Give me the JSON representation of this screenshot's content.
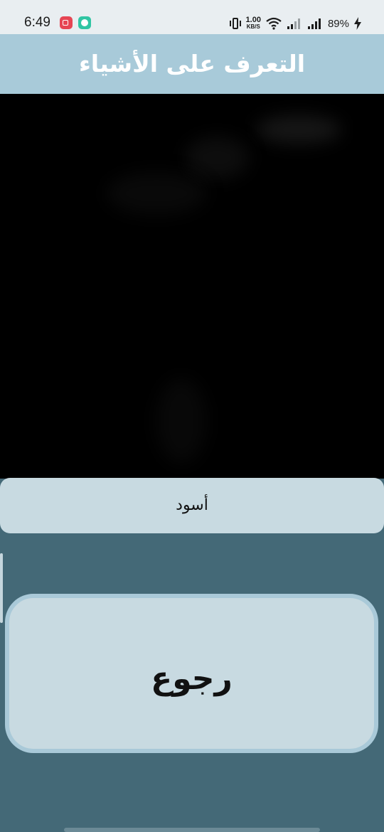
{
  "status_bar": {
    "time": "6:49",
    "net_speed_value": "1.00",
    "net_speed_unit": "KB/S",
    "battery": "89%",
    "icons": [
      "screen-record-icon",
      "chat-notification-icon",
      "vibrate-icon",
      "wifi-icon",
      "signal-icon",
      "signal-icon",
      "charging-bolt-icon"
    ]
  },
  "app_bar": {
    "title": "التعرف على الأشياء"
  },
  "result": {
    "label": "أسود"
  },
  "back_button": {
    "label": "رجوع"
  },
  "colors": {
    "background": "#446977",
    "app_bar": "#a8cad9",
    "card": "#c8dae1",
    "button_border": "#a9c9d8"
  }
}
